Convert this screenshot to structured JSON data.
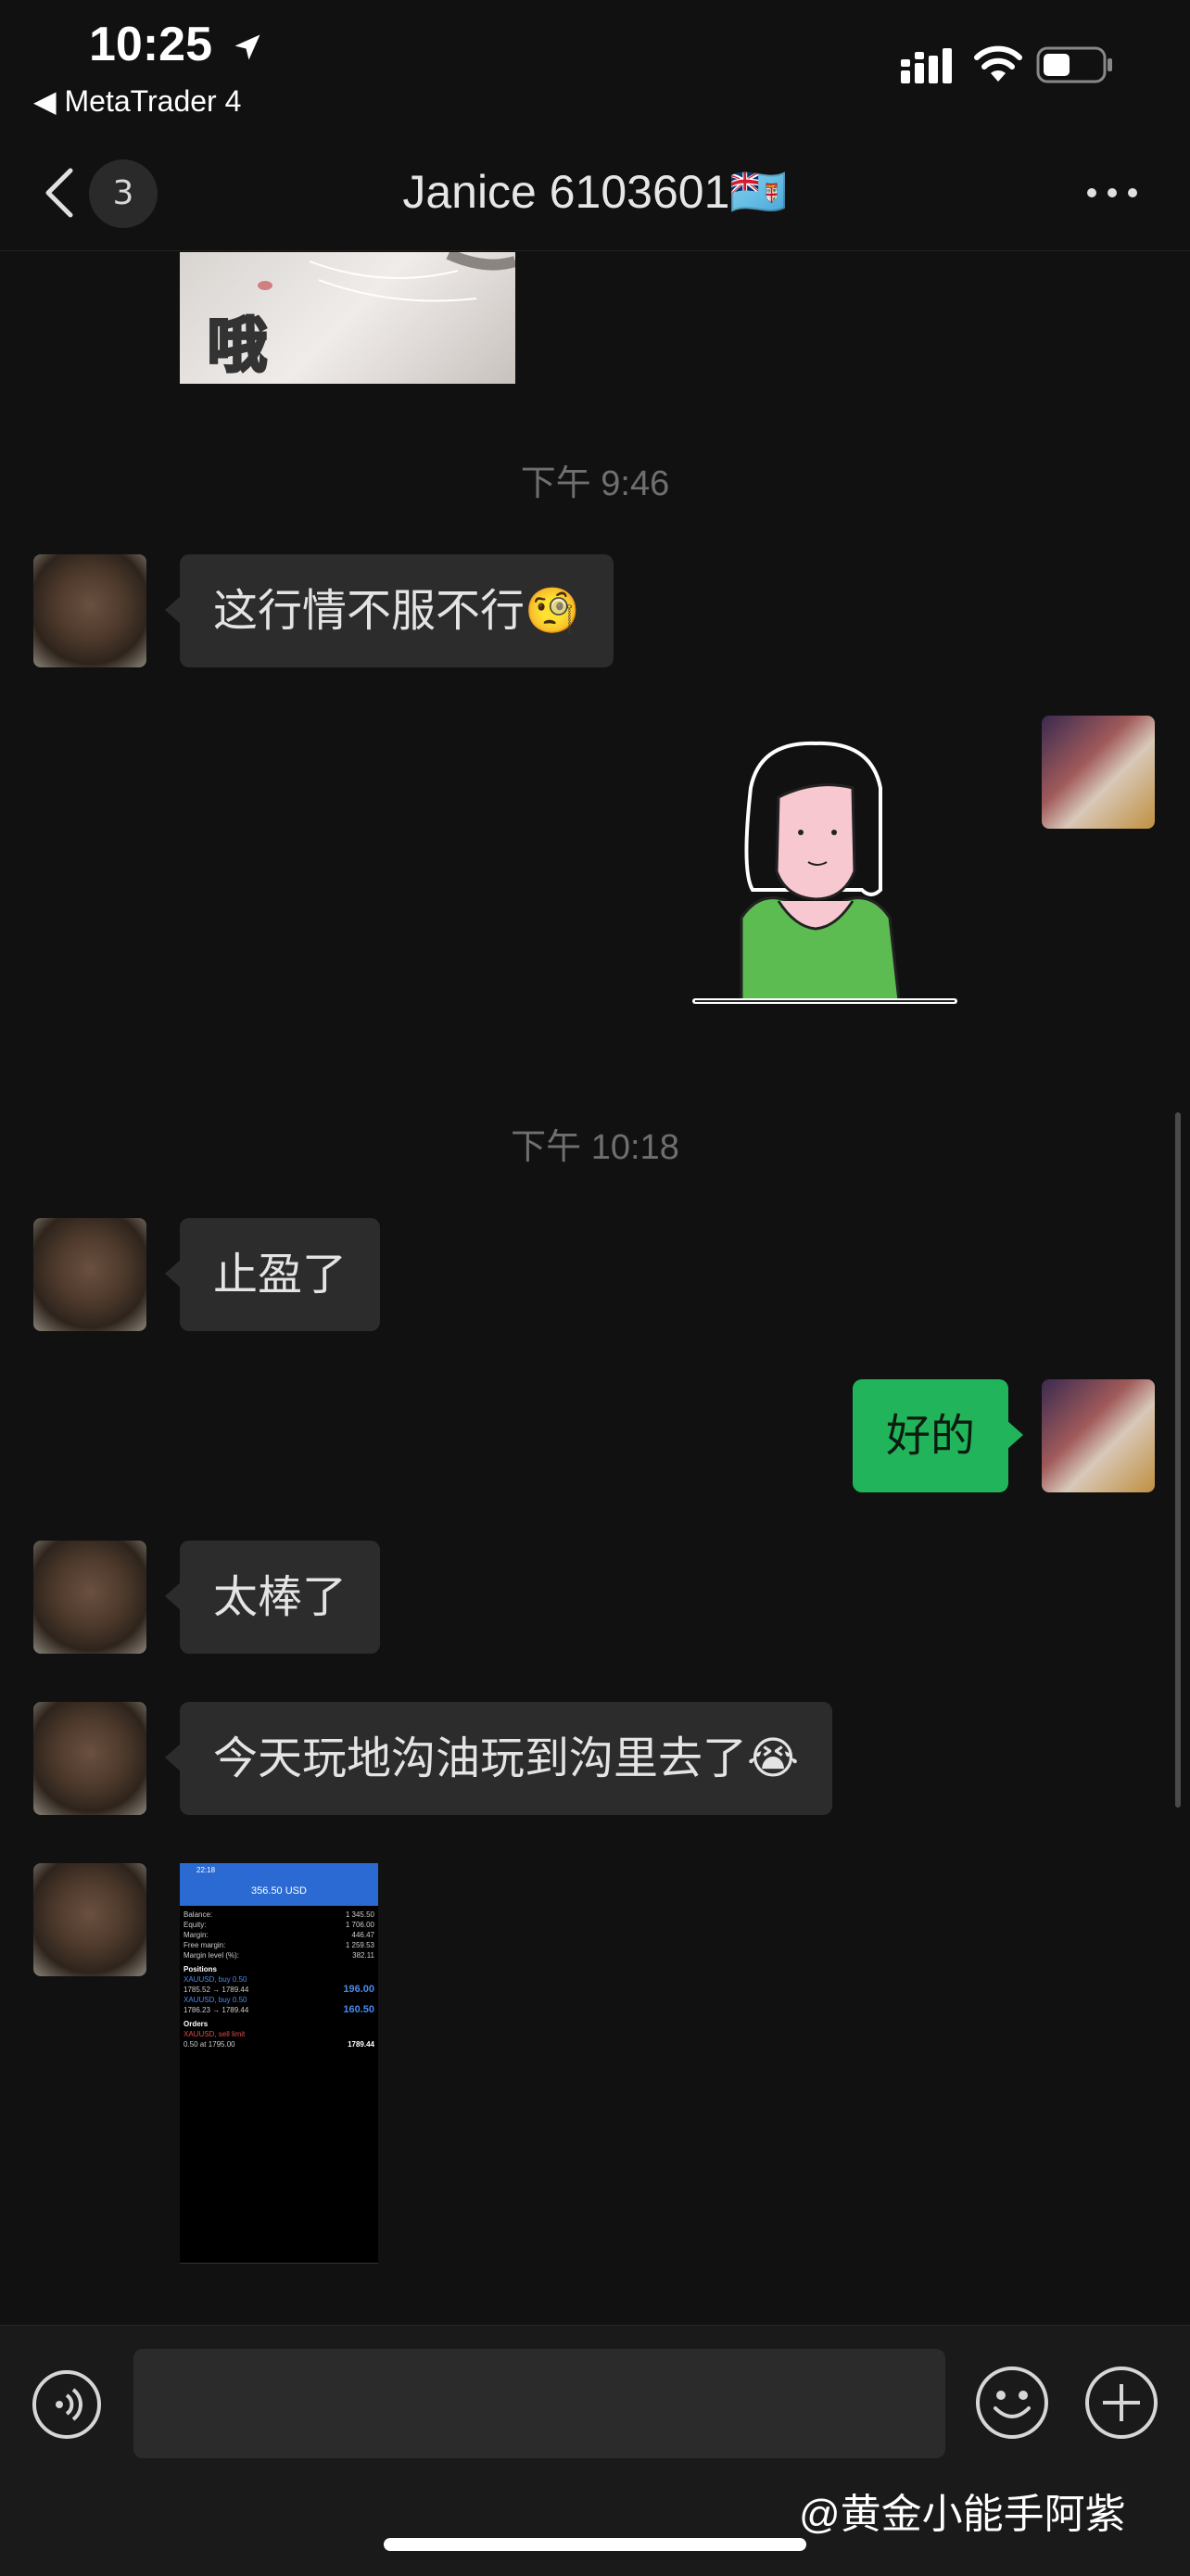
{
  "status_bar": {
    "time": "10:25",
    "back_app": "◀ MetaTrader 4"
  },
  "header": {
    "unread_count": "3",
    "title": "Janice 6103601🇫🇯"
  },
  "sticker_caption": "哦",
  "timestamps": [
    "下午 9:46",
    "下午 10:18"
  ],
  "messages": [
    {
      "side": "in",
      "text": "这行情不服不行🧐"
    },
    {
      "side": "out",
      "type": "sticker"
    },
    {
      "side": "in",
      "text": "止盈了"
    },
    {
      "side": "out",
      "text": "好的"
    },
    {
      "side": "in",
      "text": "太棒了"
    },
    {
      "side": "in",
      "text": "今天玩地沟油玩到沟里去了😭"
    }
  ],
  "mt4_screenshot": {
    "time": "22:18",
    "balance_title": "356.50 USD",
    "rows": [
      {
        "label": "Balance:",
        "value": "1 345.50"
      },
      {
        "label": "Equity:",
        "value": "1 706.00"
      },
      {
        "label": "Margin:",
        "value": "446.47"
      },
      {
        "label": "Free margin:",
        "value": "1 259.53"
      },
      {
        "label": "Margin level (%):",
        "value": "382.11"
      }
    ],
    "positions_label": "Positions",
    "positions": [
      {
        "symbol": "XAUUSD, buy 0.50",
        "detail": "1785.52 → 1789.44",
        "profit": "196.00"
      },
      {
        "symbol": "XAUUSD, buy 0.50",
        "detail": "1786.23 → 1789.44",
        "profit": "160.50"
      }
    ],
    "orders_label": "Orders",
    "order": {
      "symbol": "XAUUSD, sell limit",
      "detail": "0.50 at 1795.00",
      "price": "1789.44"
    }
  },
  "watermark": "@黄金小能手阿紫",
  "colors": {
    "background": "#111111",
    "bubble_in": "#2c2c2c",
    "bubble_out": "#22b45a",
    "mt4_blue": "#2a6ad2"
  },
  "icons": [
    "location-arrow-icon",
    "signal-icon",
    "wifi-icon",
    "battery-icon",
    "back-chevron-icon",
    "more-icon",
    "voice-icon",
    "emoji-icon",
    "add-icon"
  ]
}
